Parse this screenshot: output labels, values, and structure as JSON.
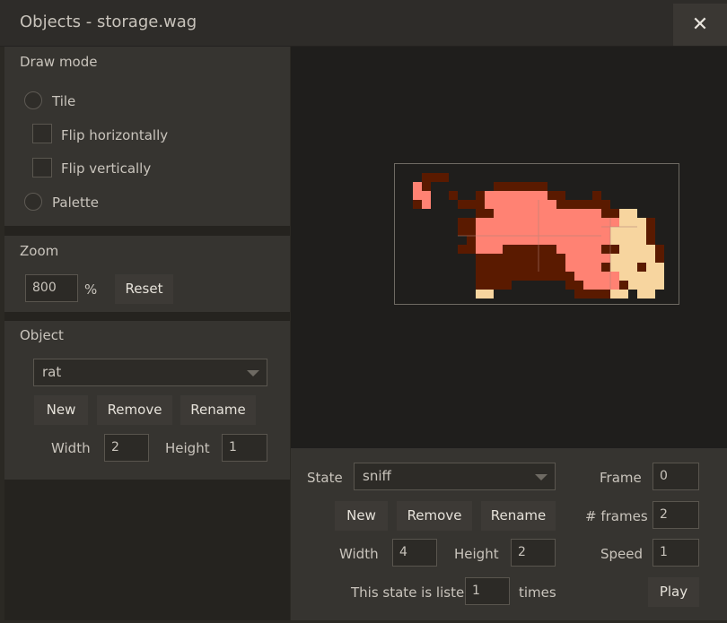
{
  "window": {
    "title": "Objects - storage.wag",
    "close_glyph": "✕"
  },
  "draw_mode": {
    "title": "Draw mode",
    "tile_label": "Tile",
    "flip_h_label": "Flip horizontally",
    "flip_v_label": "Flip vertically",
    "palette_label": "Palette"
  },
  "zoom": {
    "title": "Zoom",
    "value": "800",
    "unit": "%",
    "reset_label": "Reset"
  },
  "object": {
    "title": "Object",
    "selected": "rat",
    "new_label": "New",
    "remove_label": "Remove",
    "rename_label": "Rename",
    "width_label": "Width",
    "width_value": "2",
    "height_label": "Height",
    "height_value": "1"
  },
  "state": {
    "state_label": "State",
    "selected": "sniff",
    "new_label": "New",
    "remove_label": "Remove",
    "rename_label": "Rename",
    "width_label": "Width",
    "width_value": "4",
    "height_label": "Height",
    "height_value": "2",
    "frame_label": "Frame",
    "frame_value": "0",
    "frames_label": "# frames",
    "frames_value": "2",
    "speed_label": "Speed",
    "speed_value": "1",
    "listed_prefix": "This state is listed",
    "listed_value": "1",
    "listed_suffix": "times",
    "play_label": "Play"
  },
  "colors": {
    "pink": "#ff8273",
    "brown": "#5a1a00",
    "cream": "#f7d59f"
  }
}
